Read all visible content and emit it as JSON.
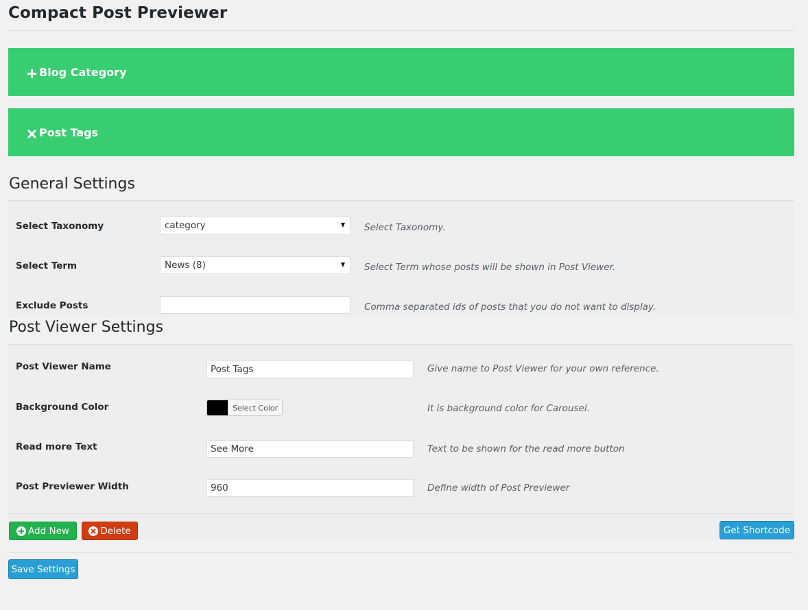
{
  "page": {
    "title": "Compact Post Previewer"
  },
  "accordions": [
    {
      "icon": "plus-icon",
      "label": "Blog Category"
    },
    {
      "icon": "close-icon",
      "label": "Post Tags"
    }
  ],
  "general": {
    "title": "General Settings",
    "taxonomy": {
      "label": "Select Taxonomy",
      "value": "category",
      "desc": "Select Taxonomy."
    },
    "term": {
      "label": "Select Term",
      "value": "News (8)",
      "desc": "Select Term whose posts will be shown in Post Viewer."
    },
    "exclude": {
      "label": "Exclude Posts",
      "value": "",
      "desc": "Comma separated ids of posts that you do not want to display."
    }
  },
  "viewer": {
    "title": "Post Viewer Settings",
    "name": {
      "label": "Post Viewer Name",
      "value": "Post Tags",
      "desc": "Give name to Post Viewer for your own reference."
    },
    "bgcolor": {
      "label": "Background Color",
      "swatch": "#000000",
      "button": "Select Color",
      "desc": "It is background color for Carousel."
    },
    "readmore": {
      "label": "Read more Text",
      "value": "See More",
      "desc": "Text to be shown for the read more button"
    },
    "width": {
      "label": "Post Previewer Width",
      "value": "960",
      "desc": "Define width of Post Previewer"
    }
  },
  "buttons": {
    "add_new": "Add New",
    "delete": "Delete",
    "get_shortcode": "Get Shortcode",
    "save_settings": "Save Settings"
  },
  "colors": {
    "accordion": "#39cd72",
    "add": "#22b14c",
    "delete": "#d13c12",
    "primary": "#2a9fd6"
  }
}
